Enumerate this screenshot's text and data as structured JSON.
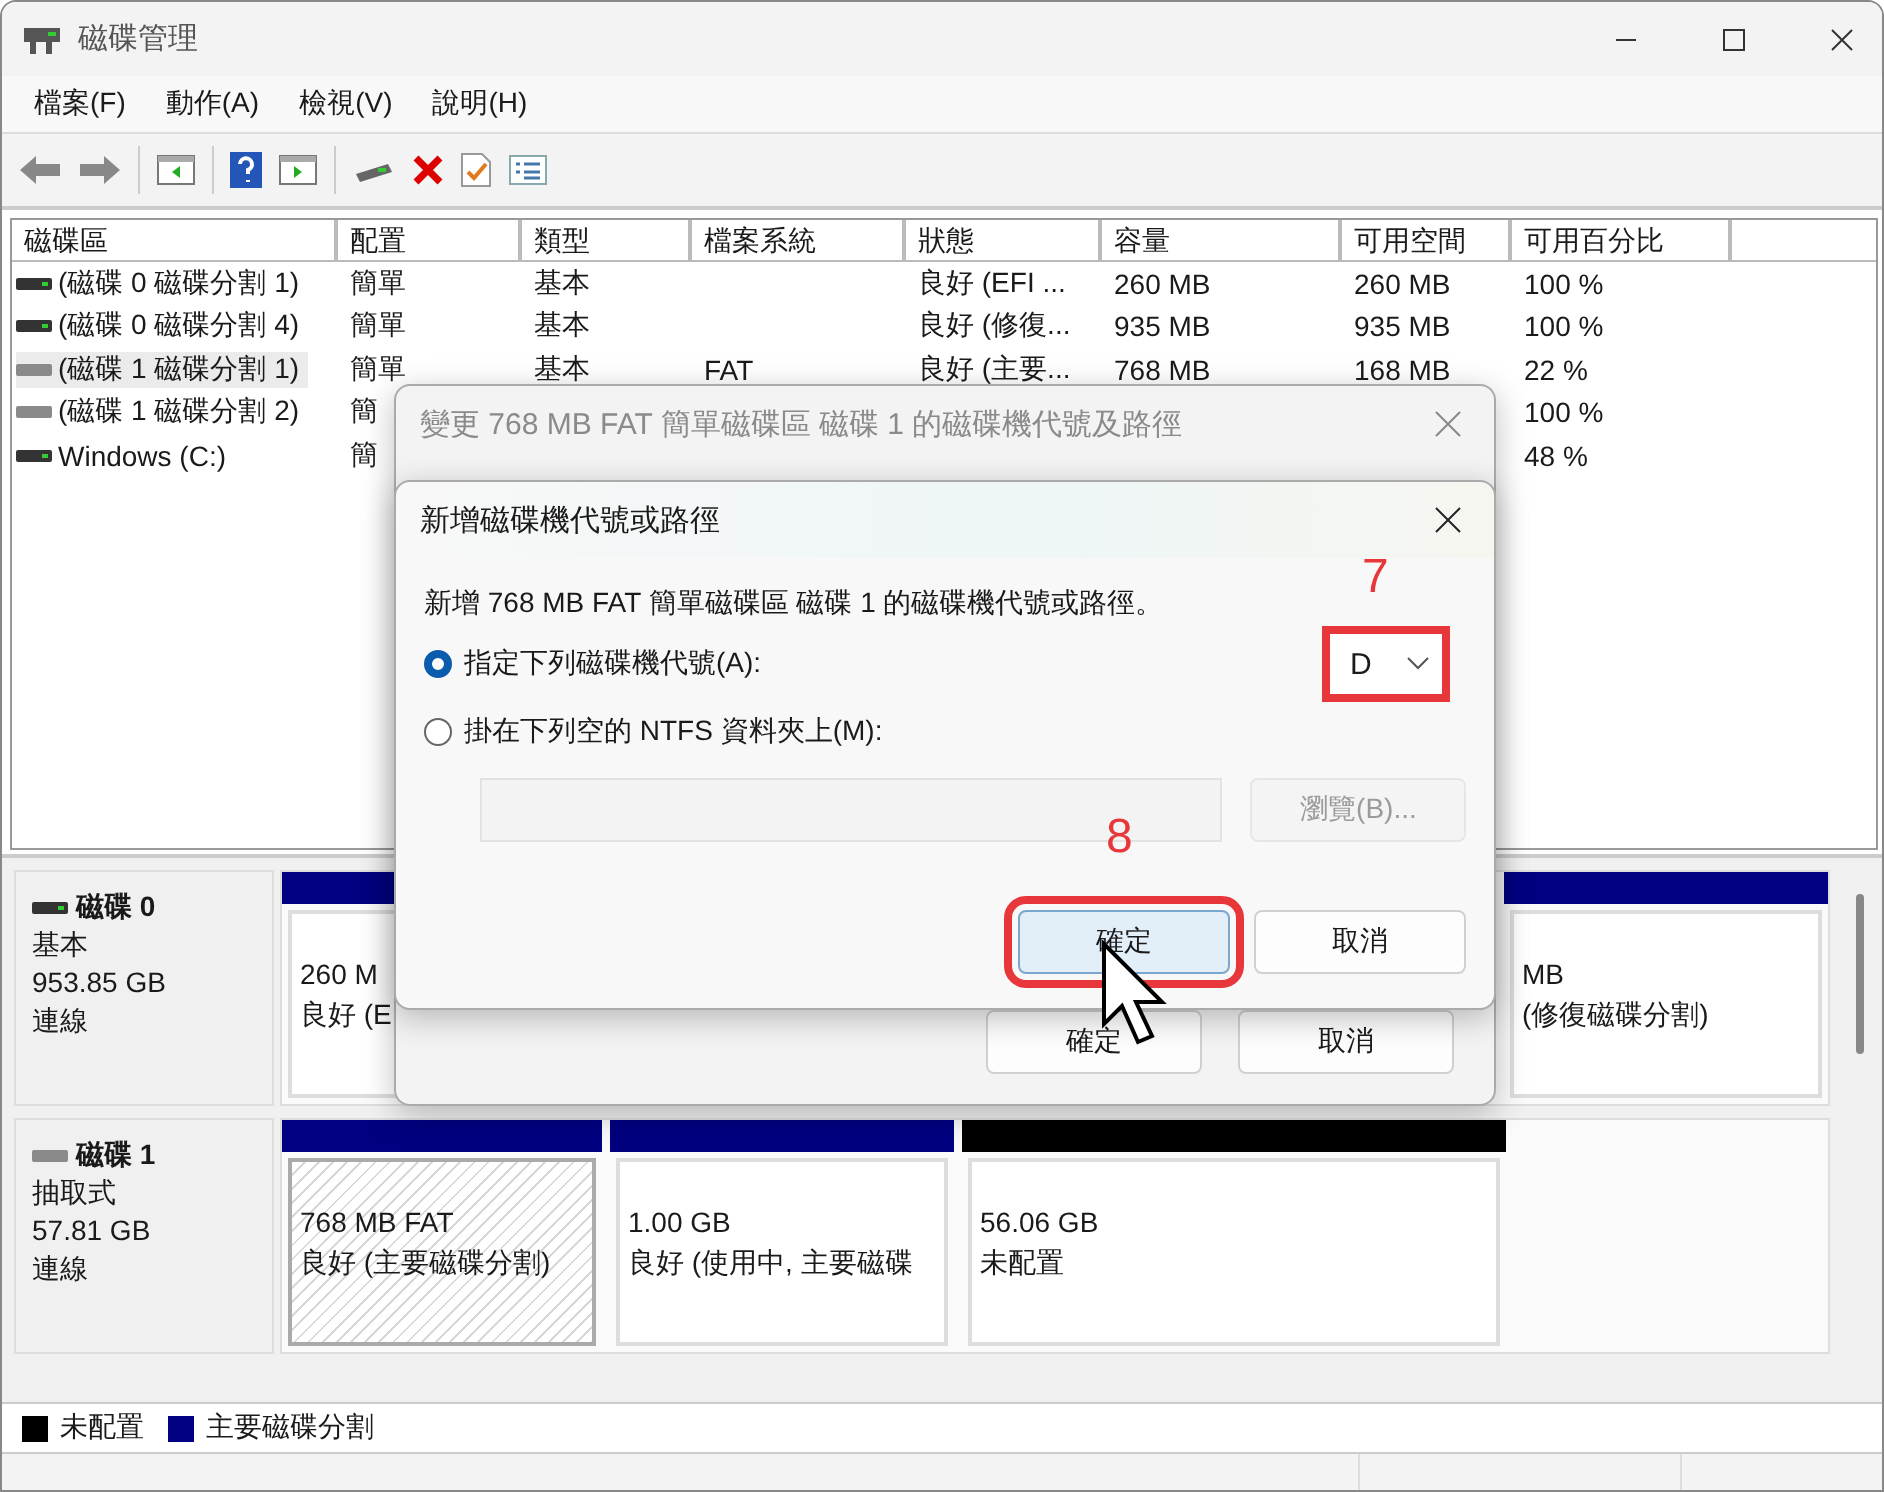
{
  "window": {
    "title": "磁碟管理"
  },
  "menu": [
    "檔案(F)",
    "動作(A)",
    "檢視(V)",
    "說明(H)"
  ],
  "volume_table": {
    "columns": [
      "磁碟區",
      "配置",
      "類型",
      "檔案系統",
      "狀態",
      "容量",
      "可用空間",
      "可用百分比"
    ],
    "rows": [
      {
        "kind": "fixed",
        "selected": false,
        "volume": "(磁碟 0 磁碟分割 1)",
        "layout": "簡單",
        "type": "基本",
        "status": "良好 (EFI ...",
        "capacity": "260 MB",
        "free": "260 MB",
        "percent": "100 %"
      },
      {
        "kind": "fixed",
        "selected": false,
        "volume": "(磁碟 0 磁碟分割 4)",
        "layout": "簡單",
        "type": "基本",
        "status": "良好 (修復...",
        "capacity": "935 MB",
        "free": "935 MB",
        "percent": "100 %"
      },
      {
        "kind": "removable",
        "selected": true,
        "volume": "(磁碟 1 磁碟分割 1)",
        "layout": "簡單",
        "type": "基本",
        "filesystem": "FAT",
        "status": "良好 (主要...",
        "capacity": "768 MB",
        "free": "168 MB",
        "percent": "22 %"
      },
      {
        "kind": "removable",
        "selected": false,
        "volume": "(磁碟 1 磁碟分割 2)",
        "layout": "簡",
        "percent": "100 %"
      },
      {
        "kind": "fixed",
        "selected": false,
        "volume": "Windows (C:)",
        "layout": "簡",
        "percent": "48 %"
      }
    ]
  },
  "disks": [
    {
      "kind": "fixed",
      "name": "磁碟 0",
      "type": "基本",
      "size": "953.85 GB",
      "status": "連線",
      "partitions": [
        {
          "kind": "primary",
          "selected": false,
          "size": "260 M",
          "status": "良好 (E"
        },
        {
          "kind": "primary",
          "selected": false,
          "size": "MB",
          "status": "(修復磁碟分割)"
        }
      ]
    },
    {
      "kind": "removable",
      "name": "磁碟 1",
      "type": "抽取式",
      "size": "57.81 GB",
      "status": "連線",
      "partitions": [
        {
          "kind": "primary",
          "selected": true,
          "size": "768 MB FAT",
          "status": "良好 (主要磁碟分割)"
        },
        {
          "kind": "primary",
          "selected": false,
          "size": "1.00 GB",
          "status": "良好 (使用中, 主要磁碟"
        },
        {
          "kind": "unallocated",
          "selected": false,
          "size": "56.06 GB",
          "status": "未配置"
        }
      ]
    }
  ],
  "legend": [
    {
      "label": "未配置",
      "color": "#000000"
    },
    {
      "label": "主要磁碟分割",
      "color": "#000080"
    }
  ],
  "back_dialog": {
    "title": "變更 768 MB FAT 簡單磁碟區 磁碟 1 的磁碟機代號及路徑",
    "active": false,
    "buttons": [
      {
        "label": "確定"
      },
      {
        "label": "取消"
      }
    ]
  },
  "front_dialog": {
    "title": "新增磁碟機代號或路徑",
    "active": true,
    "prompt": "新增 768 MB FAT 簡單磁碟區 磁碟 1 的磁碟機代號或路徑。",
    "options": [
      {
        "label": "指定下列磁碟機代號(A):",
        "selected": true
      },
      {
        "label": "掛在下列空的 NTFS 資料夾上(M):",
        "selected": false
      }
    ],
    "drive_letter": {
      "value": "D",
      "step": "7"
    },
    "path_field": {
      "disabled": true
    },
    "browse_button": {
      "label": "瀏覽(B)...",
      "disabled": true
    },
    "buttons": [
      {
        "label": "確定",
        "focused": true,
        "step": "8"
      },
      {
        "label": "取消",
        "focused": false
      }
    ]
  }
}
